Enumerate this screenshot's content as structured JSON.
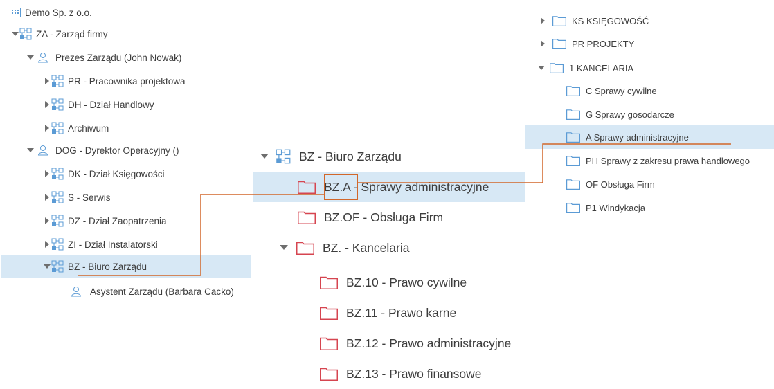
{
  "colors": {
    "accent": "#d2672a",
    "highlight": "#d7e8f5",
    "folder_red": "#d64550",
    "icon_blue": "#5b9bd5"
  },
  "left_tree": {
    "root": "Demo Sp. z o.o.",
    "items": [
      {
        "label": "ZA - Zarząd firmy"
      },
      {
        "label": "Prezes Zarządu (John Nowak)"
      },
      {
        "label": "PR - Pracownika projektowa"
      },
      {
        "label": "DH - Dział Handlowy"
      },
      {
        "label": "Archiwum"
      },
      {
        "label": "DOG - Dyrektor Operacyjny ()"
      },
      {
        "label": "DK - Dział Księgowości"
      },
      {
        "label": "S - Serwis"
      },
      {
        "label": "DZ - Dział Zaopatrzenia"
      },
      {
        "label": "ZI - Dział Instalatorski"
      },
      {
        "label": "BZ - Biuro Zarządu"
      },
      {
        "label": "Asystent Zarządu (Barbara Cacko)"
      }
    ]
  },
  "middle_tree": {
    "items": [
      {
        "label": "BZ - Biuro Zarządu"
      },
      {
        "prefix": "BZ.",
        "code": "A",
        "rest": " - Sprawy administracyjne"
      },
      {
        "label": "BZ.OF - Obsługa Firm"
      },
      {
        "label": "BZ. - Kancelaria"
      },
      {
        "label": "BZ.10 - Prawo cywilne"
      },
      {
        "label": "BZ.11 - Prawo karne"
      },
      {
        "label": "BZ.12 - Prawo administracyjne"
      },
      {
        "label": "BZ.13 - Prawo finansowe"
      }
    ]
  },
  "right_tree": {
    "items": [
      {
        "label": "KS KSIĘGOWOŚĆ"
      },
      {
        "label": "PR PROJEKTY"
      },
      {
        "label": "1 KANCELARIA"
      },
      {
        "label": "C Sprawy cywilne"
      },
      {
        "label": "G Sprawy gosodarcze"
      },
      {
        "label": "A Sprawy administracyjne"
      },
      {
        "label": "PH Sprawy z zakresu prawa handlowego"
      },
      {
        "label": "OF Obsługa Firm"
      },
      {
        "label": "P1 Windykacja"
      }
    ]
  }
}
